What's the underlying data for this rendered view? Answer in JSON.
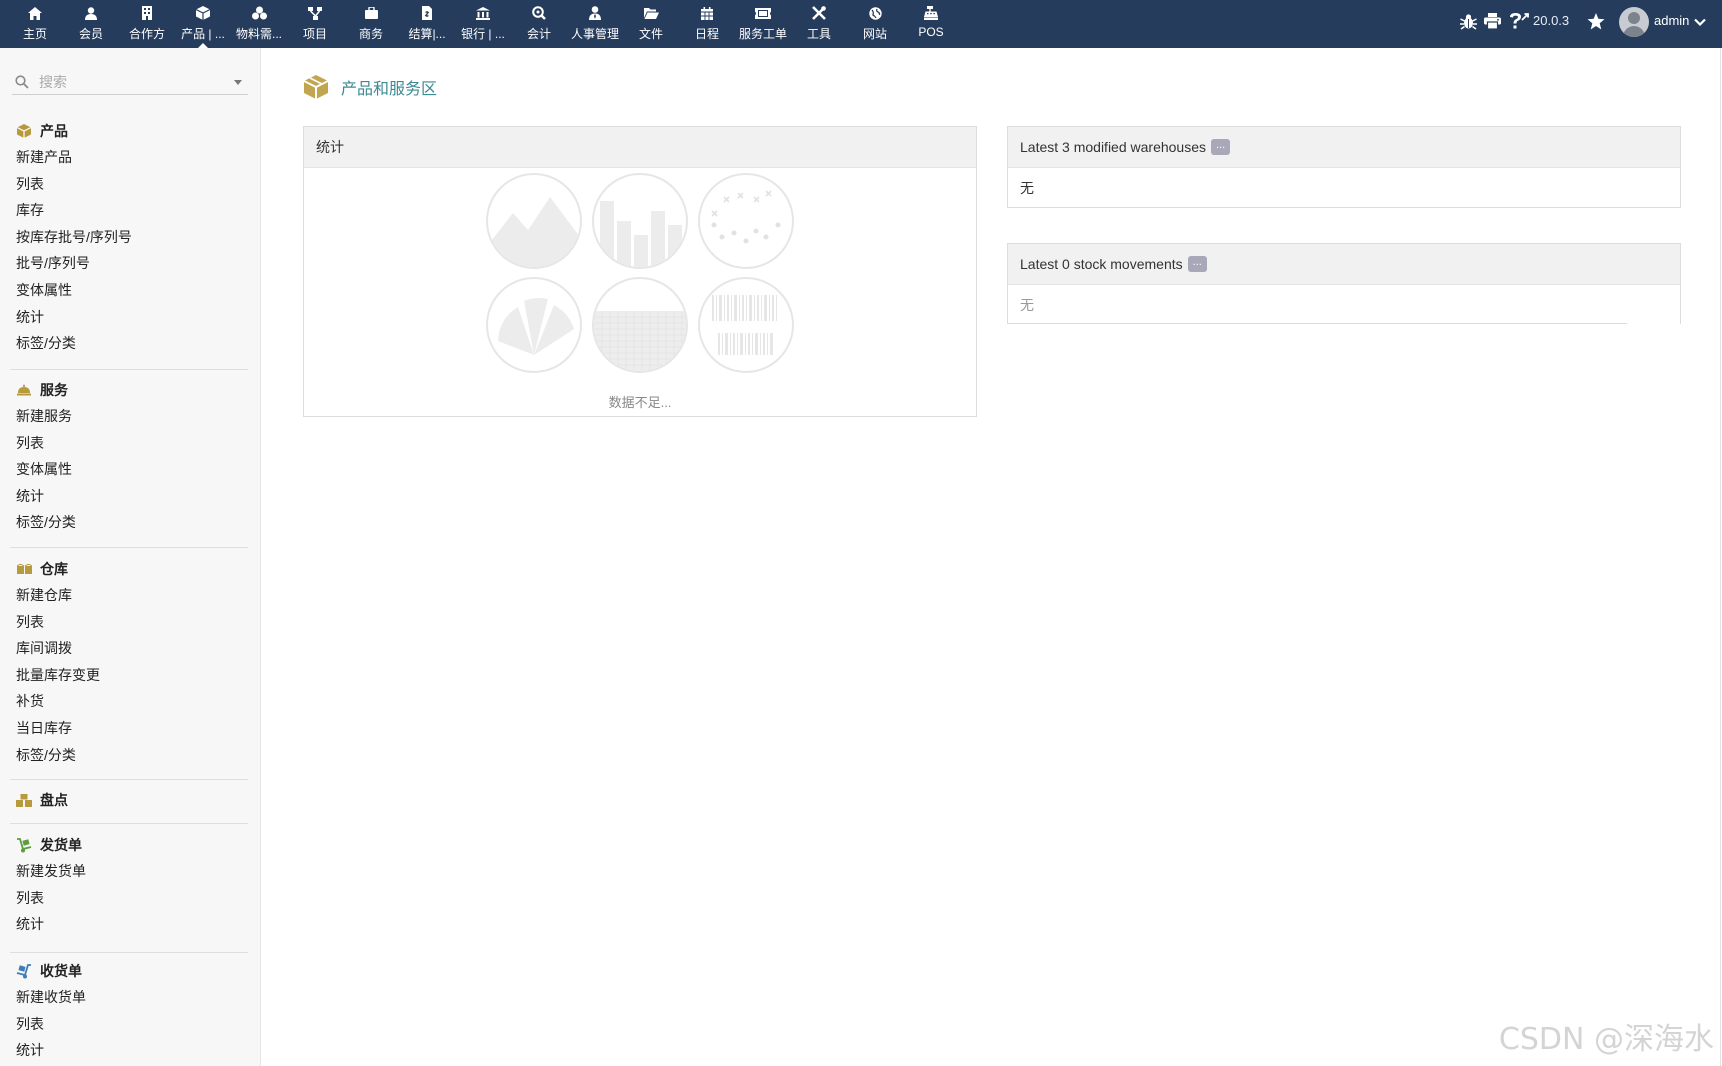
{
  "topnav": {
    "items": [
      {
        "label": "主页",
        "icon": "home-icon"
      },
      {
        "label": "会员",
        "icon": "user-icon"
      },
      {
        "label": "合作方",
        "icon": "building-icon"
      },
      {
        "label": "产品 | ...",
        "icon": "cube-icon",
        "active": true
      },
      {
        "label": "物料需...",
        "icon": "cubes-icon"
      },
      {
        "label": "项目",
        "icon": "sitemap-icon"
      },
      {
        "label": "商务",
        "icon": "briefcase-icon"
      },
      {
        "label": "结算|...",
        "icon": "invoice-icon"
      },
      {
        "label": "银行 | ...",
        "icon": "bank-icon"
      },
      {
        "label": "会计",
        "icon": "search-dollar-icon"
      },
      {
        "label": "人事管理",
        "icon": "user-tie-icon"
      },
      {
        "label": "文件",
        "icon": "folder-open-icon"
      },
      {
        "label": "日程",
        "icon": "calendar-icon"
      },
      {
        "label": "服务工单",
        "icon": "ticket-icon"
      },
      {
        "label": "工具",
        "icon": "tools-icon"
      },
      {
        "label": "网站",
        "icon": "globe-icon"
      },
      {
        "label": "POS",
        "icon": "cash-register-icon"
      }
    ],
    "version": "20.0.3",
    "username": "admin",
    "colors": {
      "bar": "#263c5c"
    }
  },
  "sidebar": {
    "search_placeholder": "搜索",
    "sections": [
      {
        "title": "产品",
        "icon": "cube-icon",
        "items": [
          "新建产品",
          "列表",
          "库存",
          "按库存批号/序列号",
          "批号/序列号",
          "变体属性",
          "统计",
          "标签/分类"
        ]
      },
      {
        "title": "服务",
        "icon": "concierge-bell-icon",
        "items": [
          "新建服务",
          "列表",
          "变体属性",
          "统计",
          "标签/分类"
        ]
      },
      {
        "title": "仓库",
        "icon": "boxes-icon",
        "items": [
          "新建仓库",
          "列表",
          "库间调拨",
          "批量库存变更",
          "补货",
          "当日库存",
          "标签/分类"
        ]
      },
      {
        "title": "盘点",
        "icon": "boxes-stack-icon",
        "items": []
      },
      {
        "title": "发货单",
        "icon": "dolly-icon",
        "items": [
          "新建发货单",
          "列表",
          "统计"
        ]
      },
      {
        "title": "收货单",
        "icon": "dolly-flatbed-icon",
        "items": [
          "新建收货单",
          "列表",
          "统计"
        ]
      }
    ]
  },
  "main": {
    "page_title": "产品和服务区",
    "stats_panel": {
      "title": "统计",
      "empty_text": "数据不足..."
    },
    "warehouses_panel": {
      "title": "Latest 3 modified warehouses",
      "badge": "...",
      "empty": "无"
    },
    "movements_panel": {
      "title": "Latest 0 stock movements",
      "badge": "...",
      "empty": "无"
    }
  },
  "watermark": "CSDN @深海水"
}
